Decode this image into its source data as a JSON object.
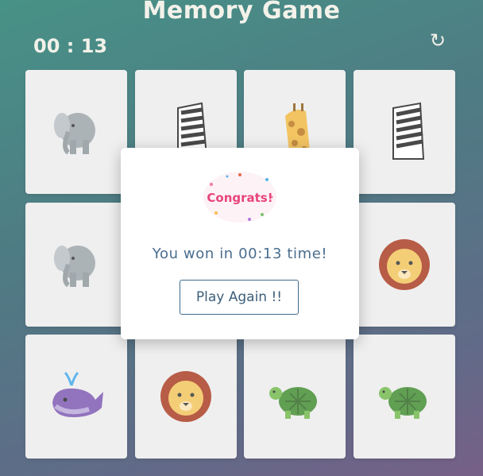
{
  "header": {
    "title": "Memory Game",
    "timer": "00 : 13",
    "restart_icon": "restart-icon"
  },
  "cards": [
    {
      "animal": "elephant-icon"
    },
    {
      "animal": "zebra-icon"
    },
    {
      "animal": "giraffe-icon"
    },
    {
      "animal": "zebra-icon"
    },
    {
      "animal": "elephant-icon"
    },
    {
      "animal": "hidden"
    },
    {
      "animal": "hidden"
    },
    {
      "animal": "lion-icon"
    },
    {
      "animal": "whale-icon"
    },
    {
      "animal": "lion-icon"
    },
    {
      "animal": "turtle-icon"
    },
    {
      "animal": "turtle-icon"
    }
  ],
  "modal": {
    "image_text": "Congrats!",
    "message": "You won in 00:13 time!",
    "play_again_label": "Play Again !!"
  },
  "colors": {
    "card": "#ececec",
    "accent": "#3d6b8c",
    "title": "#f1efe6"
  }
}
